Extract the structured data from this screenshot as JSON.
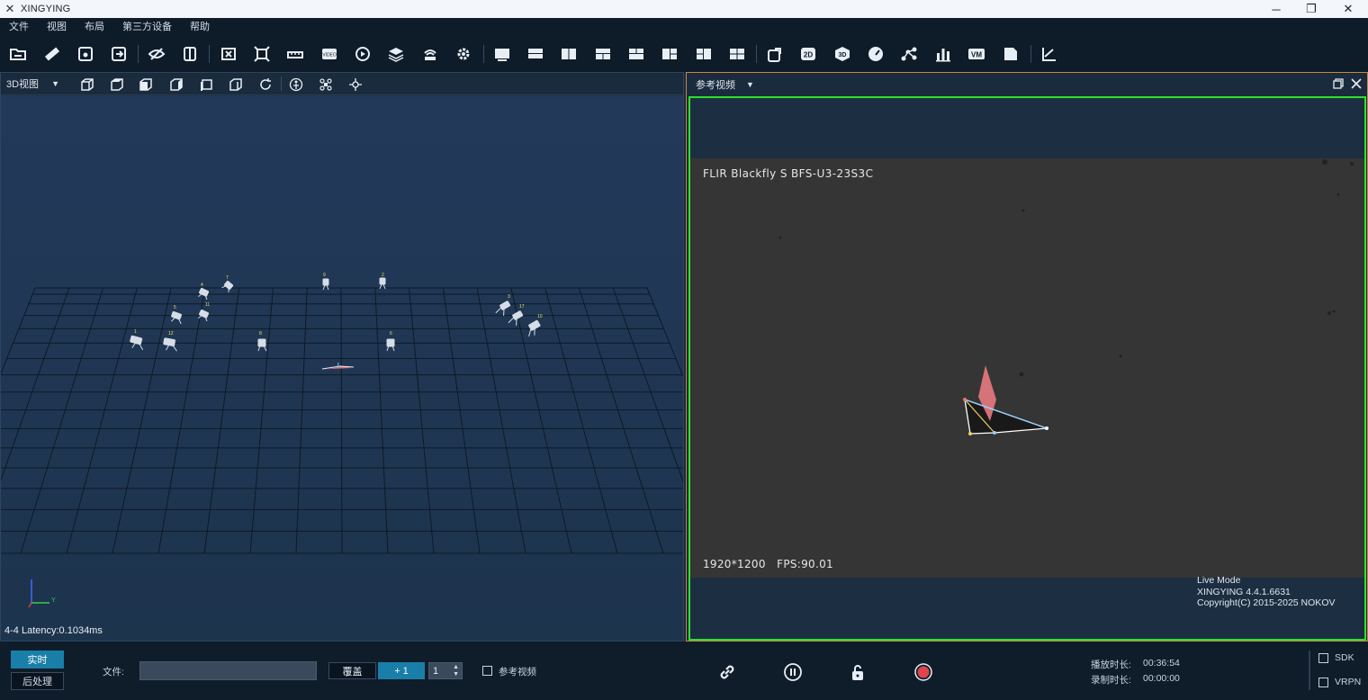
{
  "app": {
    "title": "XINGYING",
    "logo_icon": "xingying-logo-icon"
  },
  "menu": [
    "文件",
    "视图",
    "布局",
    "第三方设备",
    "帮助"
  ],
  "toolbar_icons": [
    "open-folder-icon",
    "ruler-icon",
    "save-icon",
    "save-as-icon",
    "eye-hide-icon",
    "flip-icon",
    "close-box-icon",
    "fit-icon",
    "timeline-icon",
    "video-icon",
    "replay-icon",
    "layers-icon",
    "network-icon",
    "settings-gear-icon",
    "layout-single-icon",
    "layout-two-row-icon",
    "layout-two-col-icon",
    "layout-grid-icon",
    "layout-top-icon",
    "layout-left-icon",
    "layout-right-icon",
    "layout-quad-icon",
    "rotate-camera-icon",
    "2d-view-icon",
    "3d-view-icon",
    "speed-gauge-icon",
    "skeleton-icon",
    "bar-chart-icon",
    "vm-icon",
    "document-icon",
    "axis-icon"
  ],
  "left_panel": {
    "view_select": "3D视图",
    "view_icons": [
      "cube-front-icon",
      "cube-top-icon",
      "cube-side-icon",
      "cube-back-icon",
      "cube-left-icon",
      "cube-right-icon",
      "refresh-icon",
      "person-icon",
      "drone-icon",
      "marker-icon"
    ],
    "latency": "4-4 Latency:0.1034ms",
    "camera_labels": [
      "1",
      "12",
      "5",
      "11",
      "8",
      "4",
      "7",
      "3",
      "9",
      "6",
      "17",
      "10",
      "2"
    ],
    "axis_y_label": "Y"
  },
  "right_panel": {
    "title": "参考视频",
    "camera_name": "FLIR Blackfly S BFS-U3-23S3C",
    "resolution": "1920*1200",
    "fps": "FPS:90.01",
    "info_lines": [
      "Live Mode",
      "XINGYING 4.4.1.6631",
      "Copyright(C) 2015-2025 NOKOV"
    ]
  },
  "bottom": {
    "mode_realtime": "实时",
    "mode_post": "后处理",
    "file_label": "文件:",
    "file_value": "",
    "overwrite": "覆盖",
    "plus_one": "+ 1",
    "spin_value": "1",
    "ref_video_label": "参考视频",
    "play_duration_label": "播放时长:",
    "play_duration_value": "00:36:54",
    "record_duration_label": "录制时长:",
    "record_duration_value": "00:00:00",
    "sdk_label": "SDK",
    "vrpn_label": "VRPN"
  },
  "colors": {
    "accent": "#1a7fa8",
    "video_border": "#2ee02e",
    "record": "#e0444c"
  }
}
